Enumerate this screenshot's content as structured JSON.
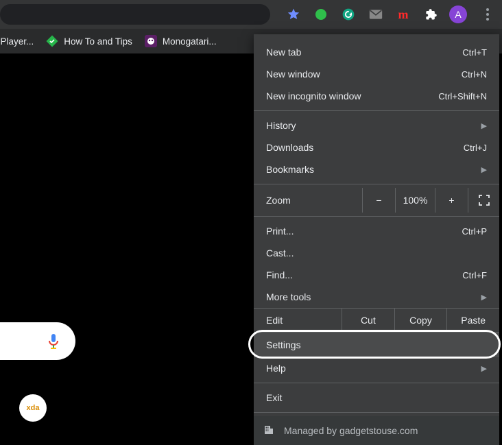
{
  "toolbar": {
    "profile_initial": "A",
    "red_m": "m"
  },
  "bookmarks": {
    "item1_trunc": "-Player...",
    "item2_label": "How To and Tips",
    "item3_label": "Monogatari..."
  },
  "menu": {
    "new_tab": "New tab",
    "new_tab_acc": "Ctrl+T",
    "new_window": "New window",
    "new_window_acc": "Ctrl+N",
    "incognito": "New incognito window",
    "incognito_acc": "Ctrl+Shift+N",
    "history": "History",
    "downloads": "Downloads",
    "downloads_acc": "Ctrl+J",
    "bookmarks": "Bookmarks",
    "zoom_label": "Zoom",
    "zoom_minus": "−",
    "zoom_value": "100%",
    "zoom_plus": "+",
    "print": "Print...",
    "print_acc": "Ctrl+P",
    "cast": "Cast...",
    "find": "Find...",
    "find_acc": "Ctrl+F",
    "more_tools": "More tools",
    "edit": "Edit",
    "cut": "Cut",
    "copy": "Copy",
    "paste": "Paste",
    "settings": "Settings",
    "help": "Help",
    "exit": "Exit",
    "managed": "Managed by gadgetstouse.com"
  },
  "misc": {
    "xda": "xda"
  }
}
